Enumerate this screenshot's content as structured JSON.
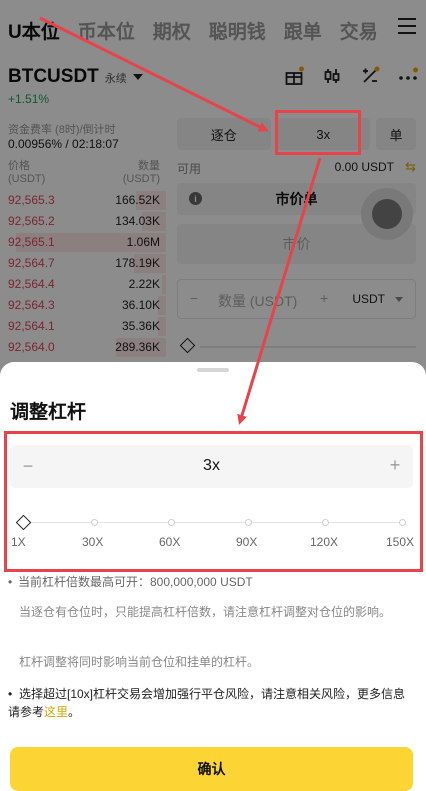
{
  "top_tabs": [
    "U本位",
    "币本位",
    "期权",
    "聪明钱",
    "跟单",
    "交易"
  ],
  "symbol": "BTCUSDT",
  "contract_type": "永续",
  "change": "+1.51%",
  "funding": {
    "label": "资金费率 (8时)/倒计时",
    "value": "0.00956% / 02:18:07"
  },
  "order_book": {
    "price_header": "价格",
    "price_unit": "(USDT)",
    "qty_header": "数量",
    "qty_unit": "(USDT)",
    "rows": [
      {
        "price": "92,565.3",
        "qty": "166.52K"
      },
      {
        "price": "92,565.2",
        "qty": "134.03K"
      },
      {
        "price": "92,565.1",
        "qty": "1.06M"
      },
      {
        "price": "92,564.7",
        "qty": "178.19K"
      },
      {
        "price": "92,564.4",
        "qty": "2.22K"
      },
      {
        "price": "92,564.3",
        "qty": "36.10K"
      },
      {
        "price": "92,564.1",
        "qty": "35.36K"
      },
      {
        "price": "92,564.0",
        "qty": "289.36K"
      }
    ]
  },
  "trade_panel": {
    "margin_mode": "逐仓",
    "leverage": "3x",
    "position_mode": "单",
    "available_label": "可用",
    "available_value": "0.00 USDT",
    "order_type": "市价单",
    "price_placeholder": "市价",
    "qty_placeholder": "数量 (USDT)",
    "qty_unit": "USDT"
  },
  "sheet": {
    "title": "调整杠杆",
    "leverage_value": "3x",
    "minus": "−",
    "plus": "+",
    "tick_labels": [
      "1X",
      "30X",
      "60X",
      "90X",
      "120X",
      "150X"
    ],
    "max_open_note": "当前杠杆倍数最高可开：800,000,000 USDT",
    "isolated_note": "当逐仓有仓位时，只能提高杠杆倍数，请注意杠杆调整对仓位的影响。",
    "sync_note": "杠杆调整将同时影响当前仓位和挂单的杠杆。",
    "risk_note_prefix": "选择超过[10x]杠杆交易会增加强行平仓风险，请注意相关风险，更多信息请参考",
    "risk_note_link": "这里",
    "risk_note_suffix": "。",
    "confirm_label": "确认"
  },
  "colors": {
    "accent": "#fcd535",
    "sell": "#e2445b",
    "buy": "#1aa260",
    "annotation": "#e8434a"
  },
  "icons": [
    "gift-icon",
    "candlestick-icon",
    "calculator-icon",
    "more-icon",
    "transfer-icon",
    "info-icon",
    "menu-icon"
  ]
}
